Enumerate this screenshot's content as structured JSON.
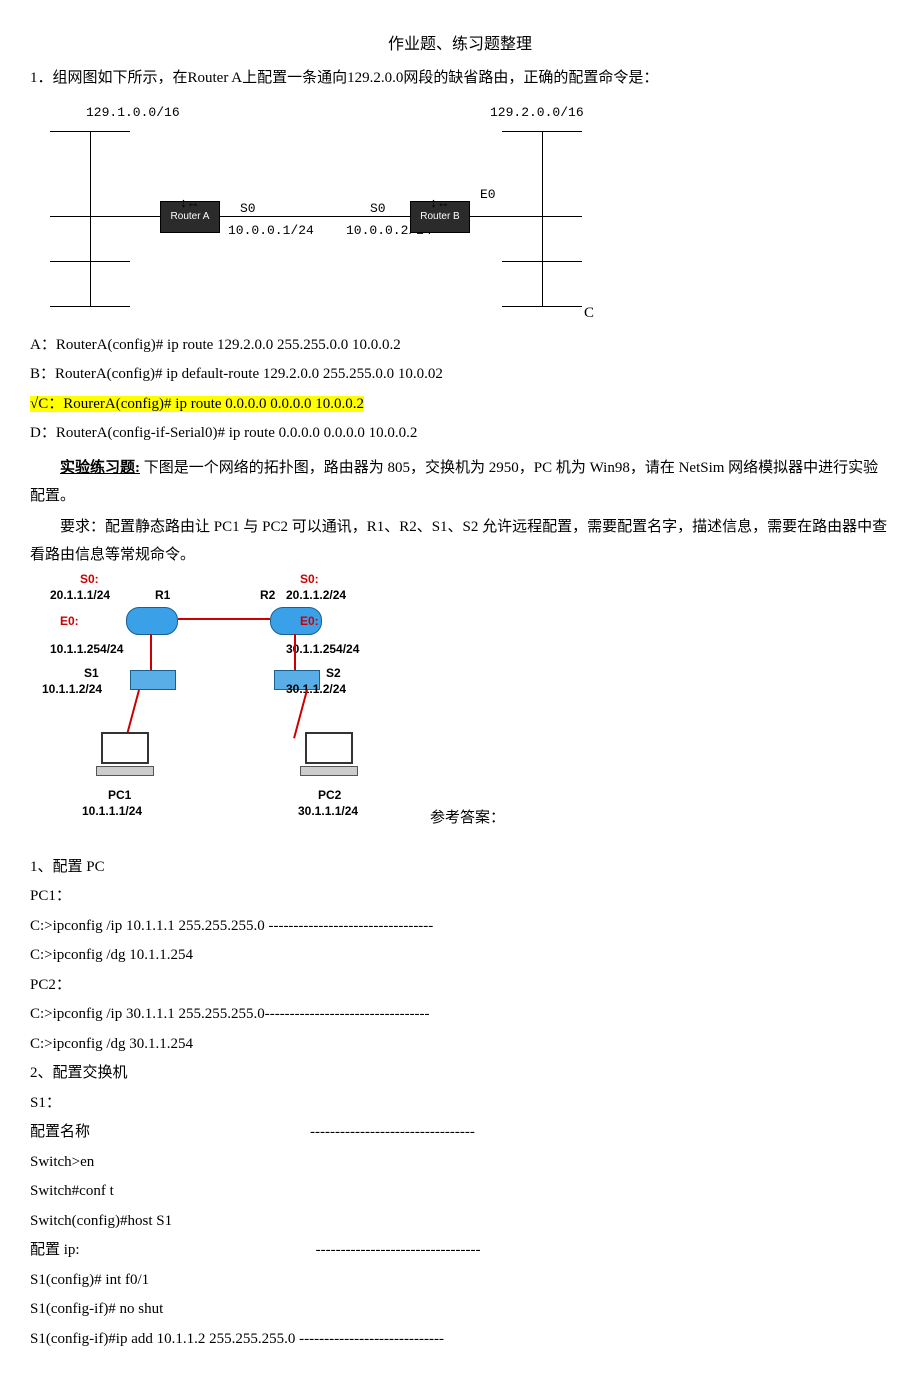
{
  "title": "作业题、练习题整理",
  "q1_text": "1．组网图如下所示，在Router A上配置一条通向129.2.0.0网段的缺省路由，正确的配置命令是：",
  "diagram1": {
    "netA": "129.1.0.0/16",
    "netB": "129.2.0.0/16",
    "s0a": "S0",
    "s0b": "S0",
    "e0": "E0",
    "routerA": "Router A",
    "routerB": "Router B",
    "ipA": "10.0.0.1/24",
    "ipB": "10.0.0.2/24",
    "cLabel": "C"
  },
  "options": {
    "A": "A：RouterA(config)# ip route 129.2.0.0 255.255.0.0 10.0.0.2",
    "B": "B：RouterA(config)# ip default-route 129.2.0.0 255.255.0.0 10.0.02",
    "C": "√C：RourerA(config)# ip route 0.0.0.0 0.0.0.0 10.0.0.2",
    "D": "D：RouterA(config-if-Serial0)# ip route 0.0.0.0 0.0.0.0 10.0.0.2"
  },
  "exercise": {
    "label": "实验练习题:",
    "p1": " 下图是一个网络的拓扑图，路由器为 805，交换机为 2950，PC 机为 Win98，请在 NetSim 网络模拟器中进行实验配置。",
    "p2": "要求：配置静态路由让 PC1 与 PC2 可以通讯，R1、R2、S1、S2 允许远程配置，需要配置名字，描述信息，需要在路由器中查看路由信息等常规命令。"
  },
  "topo": {
    "s0_label": "S0:",
    "r1_s0": "20.1.1.1/24",
    "r1_name": "R1",
    "r2_name": "R2",
    "r2_s0": "20.1.1.2/24",
    "e0_label": "E0:",
    "r1_e0": "10.1.1.254/24",
    "r2_e0": "30.1.1.254/24",
    "s1_name": "S1",
    "s1_ip": "10.1.1.2/24",
    "s2_name": "S2",
    "s2_ip": "30.1.1.2/24",
    "pc1_name": "PC1",
    "pc1_ip": "10.1.1.1/24",
    "pc2_name": "PC2",
    "pc2_ip": "30.1.1.1/24",
    "answer_label": "参考答案："
  },
  "ans": {
    "s1_title": "1、配置 PC",
    "pc1_label": "PC1：",
    "pc1_ip": "C:>ipconfig /ip    10.1.1.1    255.255.255.0        ---------------------------------",
    "pc1_dg": "C:>ipconfig /dg    10.1.1.254",
    "pc2_label": "PC2：",
    "pc2_ip": "C:>ipconfig /ip    30.1.1.1 255.255.255.0---------------------------------",
    "pc2_dg": "C:>ipconfig /dg    30.1.1.254",
    "s2_title": "2、配置交换机",
    "s1_label": "S1：",
    "name_label": "配置名称",
    "dash_long": "---------------------------------",
    "sw_en": "Switch>en",
    "sw_conf": "Switch#conf    t",
    "sw_host": "Switch(config)#host    S1",
    "ip_label": "配置 ip:",
    "s1_int": "S1(config)# int f0/1",
    "s1_noshut": "S1(config-if)# no shut",
    "s1_ipadd": "S1(config-if)#ip add    10.1.1.2    255.255.255.0 -----------------------------"
  }
}
